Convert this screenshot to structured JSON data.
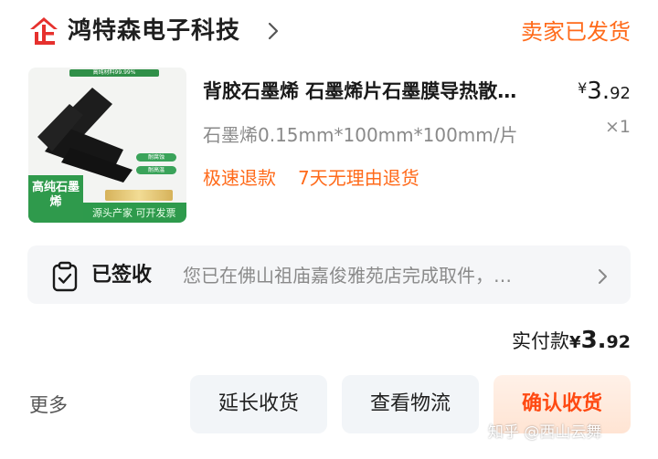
{
  "shop": {
    "name": "鸿特森电子科技",
    "logo_glyph": "企",
    "logo_color": "#e6312e",
    "status": "卖家已发货"
  },
  "product": {
    "title": "背胶石墨烯 石墨烯片石墨膜导热散…",
    "price_yen": "¥",
    "price_int": "3.",
    "price_cents": "92",
    "spec": "石墨烯0.15mm*100mm*100mm/片",
    "quantity": "×1",
    "services": [
      "极速退款",
      "7天无理由退货"
    ],
    "thumb": {
      "banner_text": "高纯材料99.99%",
      "label": "高纯石墨烯",
      "bottom_text": "源头产家 可开发票",
      "chip1": "耐腐蚀",
      "chip2": "耐高温"
    }
  },
  "logistics": {
    "status": "已签收",
    "description": "您已在佛山祖庙嘉俊雅苑店完成取件，…"
  },
  "payment": {
    "label": "实付款",
    "yen": "¥",
    "amount_int": "3.",
    "amount_cents": "92"
  },
  "actions": {
    "more": "更多",
    "extend": "延长收货",
    "view_logistics": "查看物流",
    "confirm": "确认收货"
  },
  "watermark": "知乎 @西山云舞",
  "colors": {
    "accent": "#ff6a1a",
    "confirm": "#ff4a12",
    "logo": "#e6312e"
  }
}
